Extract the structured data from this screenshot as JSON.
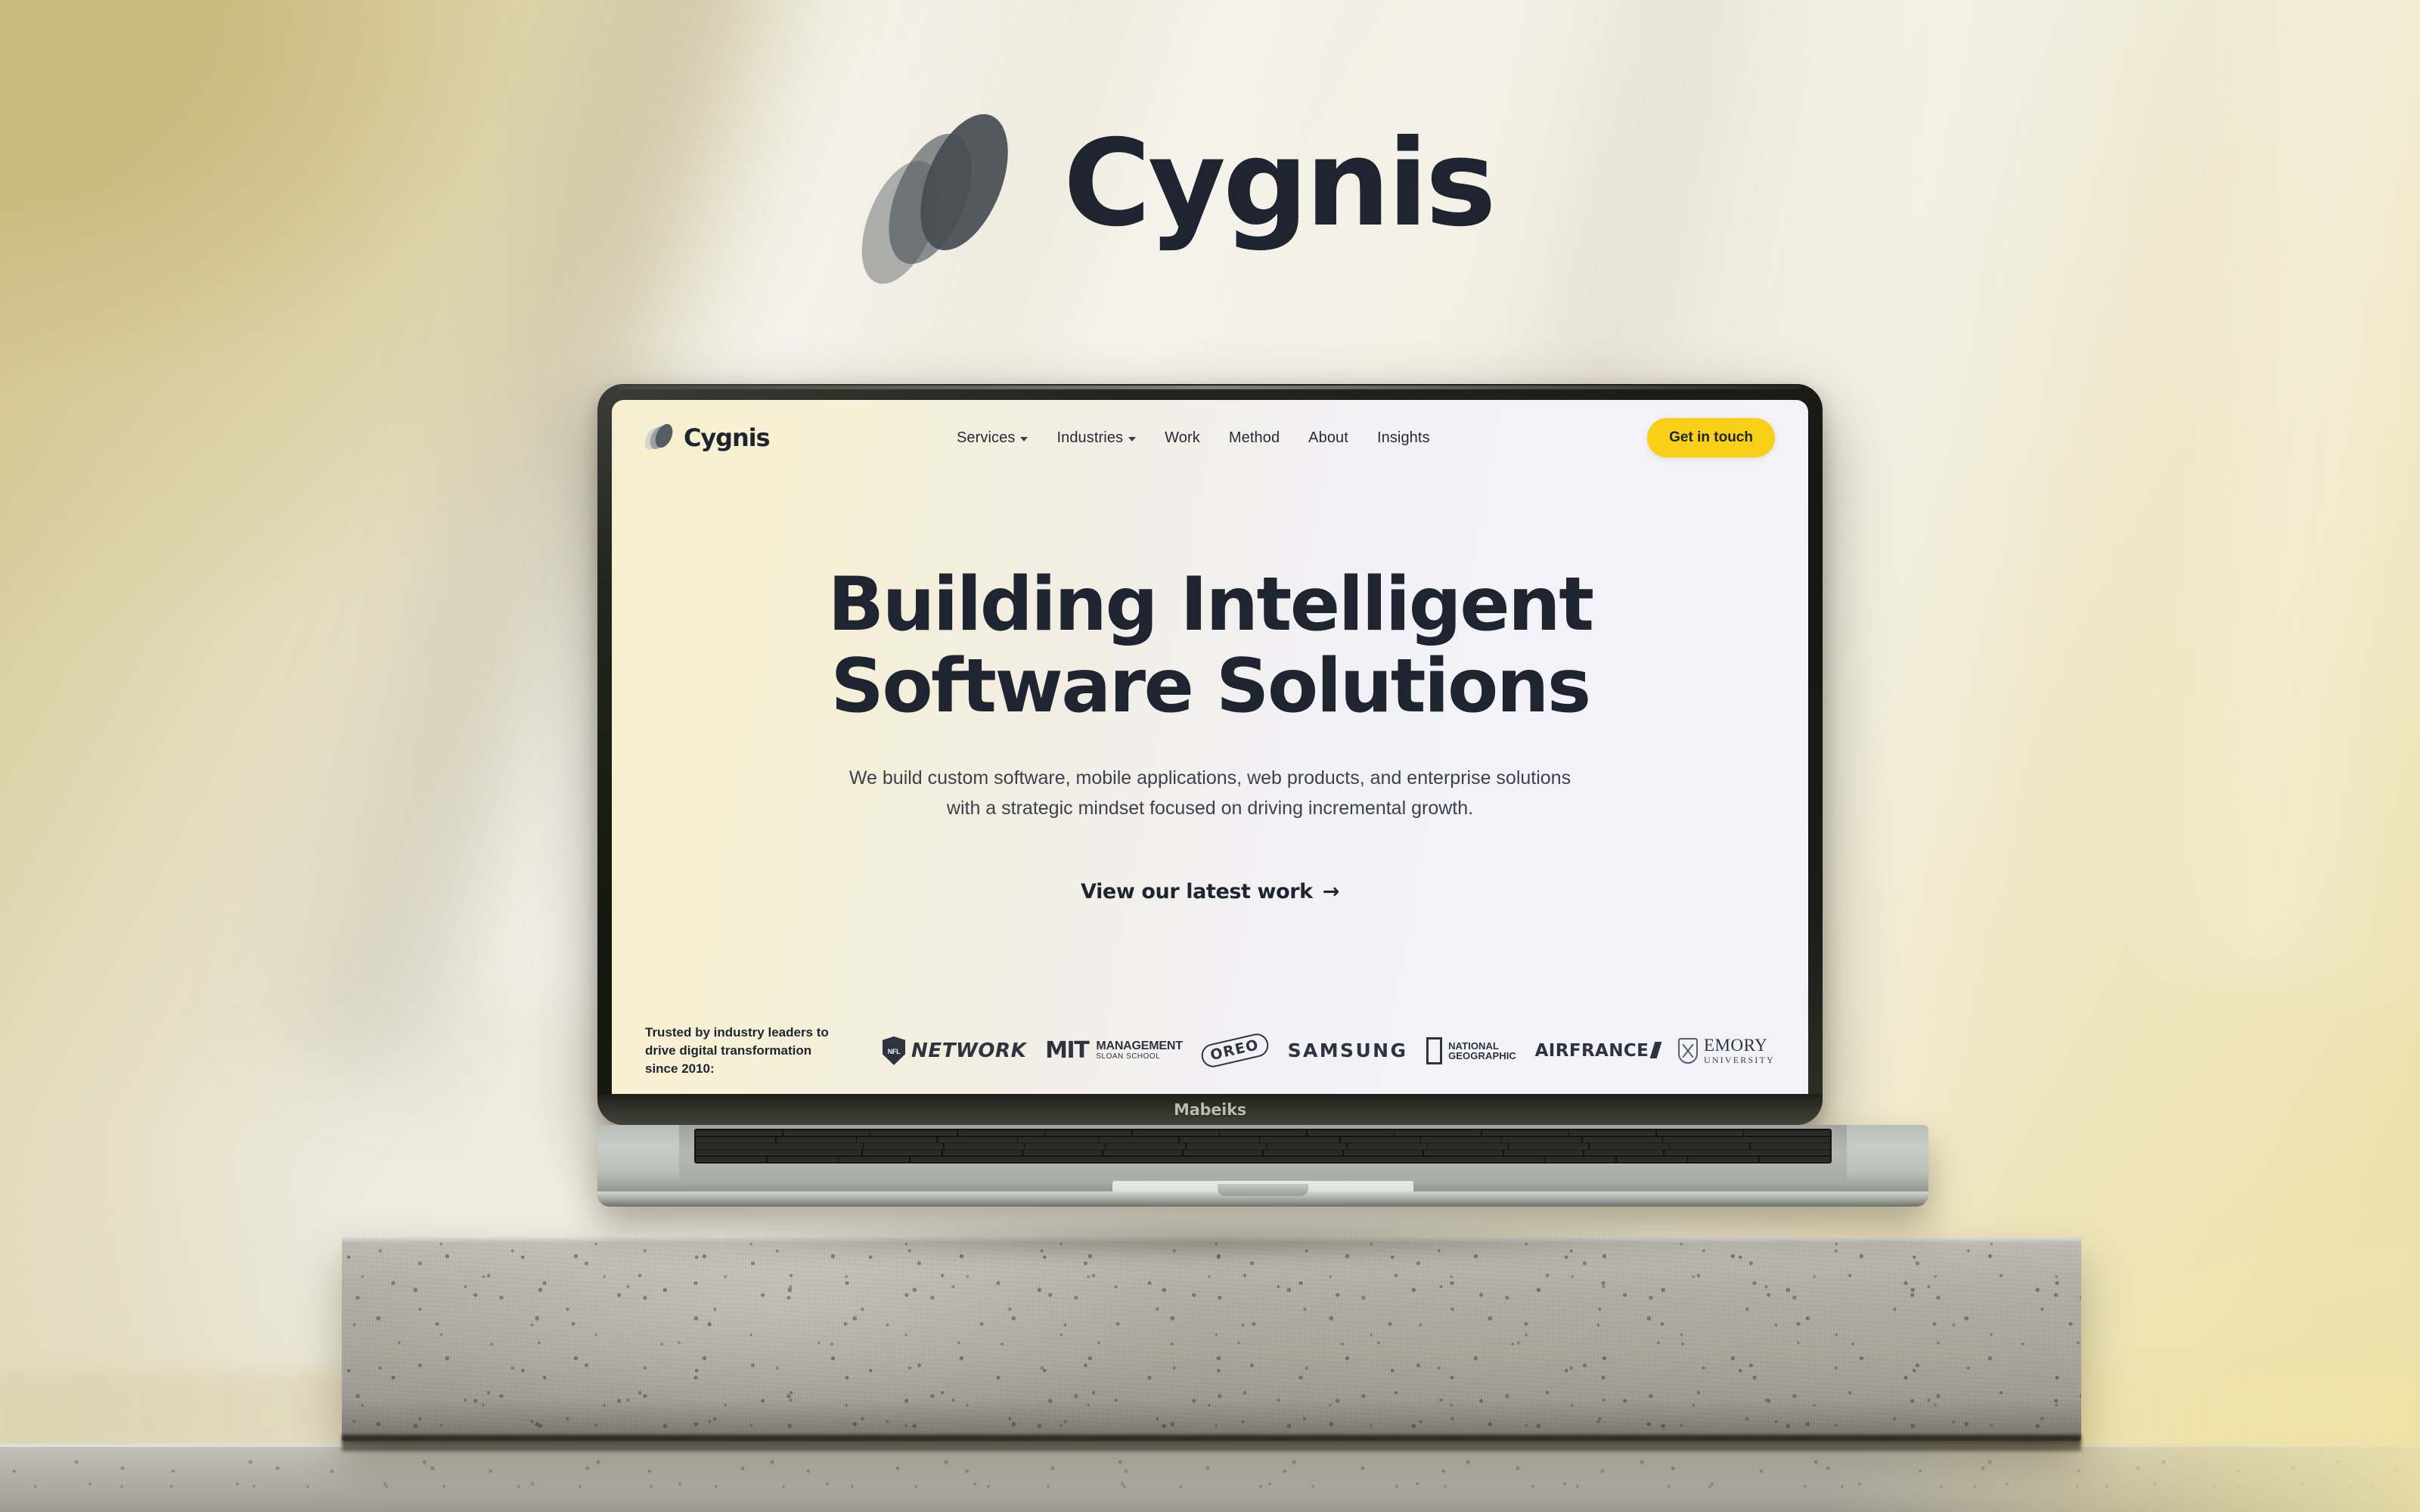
{
  "scene": {
    "wall_logo": {
      "wordmark": "Cygnis",
      "mark_name": "cygnis-ellipse-mark"
    },
    "laptop": {
      "brand_text": "Mabeiks"
    }
  },
  "site": {
    "brand": {
      "name": "Cygnis"
    },
    "nav": {
      "items": [
        {
          "label": "Services",
          "has_dropdown": true
        },
        {
          "label": "Industries",
          "has_dropdown": true
        },
        {
          "label": "Work",
          "has_dropdown": false
        },
        {
          "label": "Method",
          "has_dropdown": false
        },
        {
          "label": "About",
          "has_dropdown": false
        },
        {
          "label": "Insights",
          "has_dropdown": false
        }
      ],
      "cta_label": "Get in touch"
    },
    "hero": {
      "title_line1": "Building Intelligent",
      "title_line2": "Software Solutions",
      "subtitle": "We build custom software, mobile applications, web products, and enterprise solutions with a strategic mindset focused on driving incremental growth.",
      "cta_label": "View our latest work",
      "cta_arrow": "→"
    },
    "trusted": {
      "label_line1": "Trusted by industry leaders to drive",
      "label_line2": "digital transformation since 2010:",
      "logos": [
        {
          "name": "nfl-network",
          "primary": "NETWORK",
          "secondary": "NFL"
        },
        {
          "name": "mit-sloan",
          "primary": "MIT",
          "secondary": "MANAGEMENT",
          "tertiary": "SLOAN SCHOOL"
        },
        {
          "name": "oreo",
          "primary": "OREO"
        },
        {
          "name": "samsung",
          "primary": "SAMSUNG"
        },
        {
          "name": "national-geographic",
          "primary": "NATIONAL",
          "secondary": "GEOGRAPHIC"
        },
        {
          "name": "airfrance",
          "primary": "AIRFRANCE"
        },
        {
          "name": "emory-university",
          "primary": "EMORY",
          "secondary": "UNIVERSITY"
        }
      ]
    },
    "colors": {
      "accent_yellow": "#F9CF18",
      "ink": "#1E2430",
      "screen_bg_left": "#F6EFCF",
      "screen_bg_right": "#F3F2F8"
    }
  }
}
